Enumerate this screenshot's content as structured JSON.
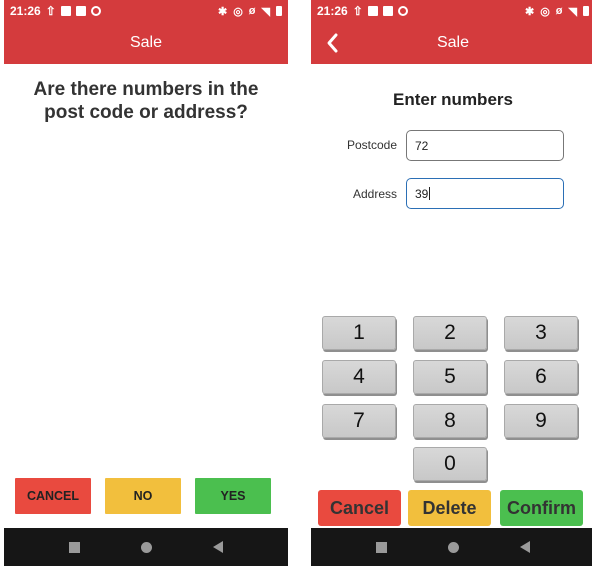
{
  "status": {
    "time": "21:26",
    "upload_icon": "upload-icon",
    "bluetooth_icon": "bluetooth-icon",
    "location_icon": "location-icon",
    "mute_icon": "mute-icon",
    "wifi_icon": "wifi-icon",
    "battery_icon": "battery-icon"
  },
  "left_screen": {
    "title": "Sale",
    "question": "Are there numbers in the post code or address?",
    "buttons": {
      "cancel": "CANCEL",
      "no": "NO",
      "yes": "YES"
    }
  },
  "right_screen": {
    "title": "Sale",
    "heading": "Enter numbers",
    "postcode_label": "Postcode",
    "postcode_value": "72",
    "address_label": "Address",
    "address_value": "39",
    "keypad": [
      "1",
      "2",
      "3",
      "4",
      "5",
      "6",
      "7",
      "8",
      "9",
      "0"
    ],
    "buttons": {
      "cancel": "Cancel",
      "delete": "Delete",
      "confirm": "Confirm"
    }
  },
  "colors": {
    "header": "#d43b3d",
    "red": "#e94a3f",
    "yellow": "#f2bf3d",
    "green": "#4bbf4f",
    "key": "#d3d3d3",
    "navbar": "#161616"
  }
}
